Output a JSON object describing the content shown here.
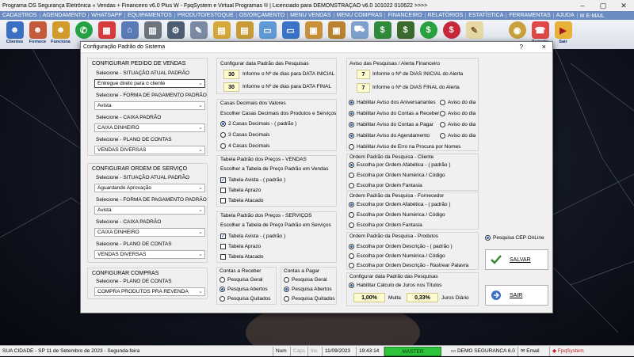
{
  "app": {
    "title": "Programa OS Segurança Eletrônica « Vendas + Financeiro v6.0 Plus W - FpqSystem e Virtual Programas ® | Licenciado para  DEMONSTRAÇÃO v6.0 101022 010622 >>>>"
  },
  "menu": [
    "CADASTROS",
    "AGENDAMENTO",
    "WHATSAPP",
    "EQUIPAMENTOS",
    "PRODUTO/ESTOQUE",
    "OS/ORÇAMENTO",
    "MENU VENDAS",
    "MENU COMPRAS",
    "FINANCEIRO",
    "RELATÓRIOS",
    "ESTATÍSTICA",
    "FERRAMENTAS",
    "AJUDA",
    "E-MAIL"
  ],
  "toolbar": {
    "clientes": "Clientes",
    "fornece": "Fornece",
    "funciona": "Funciona",
    "suporte": "Suporte",
    "sair": "Sair"
  },
  "dialog": {
    "title": "Configuração Padrão do Sistema",
    "help": "?",
    "close": "×",
    "pedido": {
      "title": "CONFIGURAR PEDIDO DE VENDAS",
      "l1": "Selecione - SITUAÇÃO ATUAL PADRÃO",
      "v1": "Entregue direto para o cliente",
      "l2": "Selecione - FORMA DE PAGAMENTO PADRÃO",
      "v2": "Avista",
      "l3": "Selecione - CAIXA PADRÃO",
      "v3": "CAIXA DINHEIRO",
      "l4": "Selecione - PLANO DE CONTAS",
      "v4": "VENDAS DIVERSAS"
    },
    "os": {
      "title": "CONFIGURAR ORDEM DE SERVIÇO",
      "l1": "Selecione - SITUAÇÃO ATUAL PADRÃO",
      "v1": "Aguardando Aprovação",
      "l2": "Selecione - FORMA DE PAGAMENTO PADRÃO",
      "v2": "Avista",
      "l3": "Selecione - CAIXA PADRÃO",
      "v3": "CAIXA DINHEIRO",
      "l4": "Selecione - PLANO DE CONTAS",
      "v4": "VENDAS DIVERSAS"
    },
    "compras": {
      "title": "CONFIGURAR COMPRAS",
      "l1": "Selecione - PLANO DE CONTAS",
      "v1": "COMPRA PRODUTOS PRA REVENDA"
    },
    "datas": {
      "title": "Configurar data Padrão das Pesquisas",
      "n1": "30",
      "t1": "Informe o Nº de dias para DATA INICIAL",
      "n2": "30",
      "t2": "Informe o Nº de dias para DATA FINAL"
    },
    "casas": {
      "title": "Casas Decimais dos Valores",
      "sub": "Escolher Casas Decimais dos Produtos e Serviços",
      "o1": "2 Casas Decimais - ( padrão )",
      "o2": "3 Casas Decimais",
      "o3": "4 Casas Decimais"
    },
    "precoVendas": {
      "title": "Tabela Padrão dos Preços - VENDAS",
      "sub": "Escolher a Tabela de Preço Padrão em Vendas",
      "o1": "Tabela Avista - ( padrão )",
      "o2": "Tabela Aprazo",
      "o3": "Tabela Atacado"
    },
    "precoServicos": {
      "title": "Tabela Padrão dos Preços - SERVIÇOS",
      "sub": "Escolher a Tabela de Preço Padrão em Serviços",
      "o1": "Tabela Avista - ( padrão )",
      "o2": "Tabela Aprazo",
      "o3": "Tabela Atacado"
    },
    "receber": {
      "title": "Contas a Receber",
      "o1": "Pesquisa Geral",
      "o2": "Pesquisa Abertos",
      "o3": "Pesquisa Quitados"
    },
    "pagar": {
      "title": "Contas a Pagar",
      "o1": "Pesquisa Geral",
      "o2": "Pesquisa Abertos",
      "o3": "Pesquisa Quitados"
    },
    "aviso": {
      "title": "Aviso das Pesquisas / Alerta Financeiro",
      "n1": "7",
      "t1": "Informe o Nº de DIAS INICIAL do Alerta",
      "n2": "7",
      "t2": "Informe o Nº de DIAS FINAL do Alerta",
      "a1": "Habilitar Aviso dos Aniversariantes",
      "a2": "Habilitar Aviso do Contas a Receber",
      "a3": "Habilitar Aviso do Contas a Pagar",
      "a4": "Habilitar Aviso do Agendamento",
      "a5": "Habilitar Aviso de Erro na Procura por Nomes",
      "d": "Aviso do dia"
    },
    "ordCliente": {
      "title": "Ordem Padrão da Pesquisa - Cliente",
      "o1": "Escolha por Ordem Afabética - ( padrão )",
      "o2": "Escolha por Ordem Numérica / Código",
      "o3": "Escolha por Ordem Fantasia"
    },
    "ordFornecedor": {
      "title": "Ordem Padrão da Pesquisa - Fornecedor",
      "o1": "Escolha por Ordem Afabética - ( padrão )",
      "o2": "Escolha por Ordem Numérica / Código",
      "o3": "Escolha por Ordem Fantasia"
    },
    "ordProdutos": {
      "title": "Ordem Padrão da Pesquisa - Produtos",
      "o1": "Escolha por Ordem Descrição - ( padrão )",
      "o2": "Escolha por Ordem Numérica / Código",
      "o3": "Escolha por Ordem Descrição - Rastrear Palavra"
    },
    "juros": {
      "title": "Configurar data Padrão das Pesquisas",
      "cb": "Habilitar Calculo de Juros nos Títulos",
      "multa": "1,00%",
      "multaL": "Multa",
      "juros": "0,33%",
      "jurosL": "Juros Diário"
    },
    "cep": "Pesquisa CEP OnLine",
    "salvar": "SALVAR",
    "sair": "SAIR"
  },
  "status": {
    "cidade": "SUA CIDADE - SP 11 de Setembro de 2023 - Segunda-feira",
    "num": "Num",
    "caps": "Caps",
    "ins": "Ins",
    "data": "11/09/2023",
    "hora": "19:43:14",
    "master": "MASTER",
    "demo": "DEMO SEGURANCA 6.0",
    "email": "Email",
    "fpq": "FpqSystem"
  }
}
